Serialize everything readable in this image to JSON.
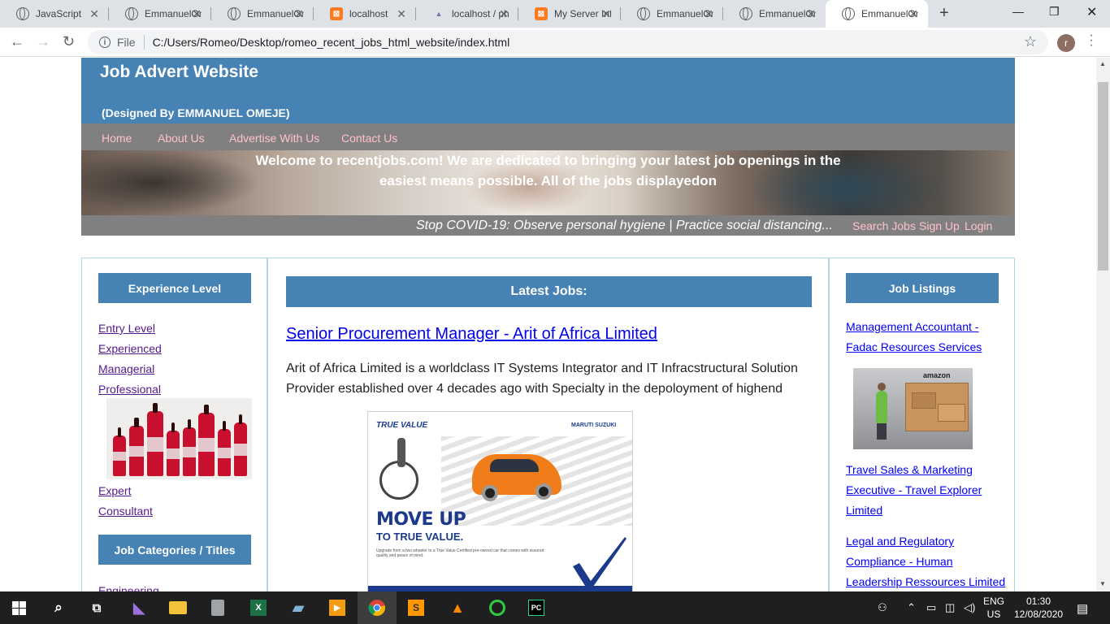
{
  "browser": {
    "tabs": [
      {
        "title": "JavaScript",
        "icon": "globe-icon"
      },
      {
        "title": "EmmanuelOmeje",
        "icon": "globe-icon"
      },
      {
        "title": "EmmanuelOmeje",
        "icon": "globe-icon"
      },
      {
        "title": "localhost",
        "icon": "xampp-icon"
      },
      {
        "title": "localhost / phpMyAdmin",
        "icon": "phpmyadmin-icon"
      },
      {
        "title": "My Server Info",
        "icon": "xampp-icon"
      },
      {
        "title": "EmmanuelOmeje",
        "icon": "globe-icon"
      },
      {
        "title": "EmmanuelOmeje",
        "icon": "globe-icon"
      },
      {
        "title": "EmmanuelOmeje",
        "icon": "globe-icon",
        "active": true
      }
    ],
    "file_label": "File",
    "url": "C:/Users/Romeo/Desktop/romeo_recent_jobs_html_website/index.html",
    "avatar_letter": "r"
  },
  "header": {
    "title": "Job Advert Website",
    "designer": "(Designed By EMMANUEL OMEJE)"
  },
  "nav": {
    "items": [
      "Home",
      "About Us",
      "Advertise With Us",
      "Contact Us"
    ]
  },
  "banner": {
    "welcome": "Welcome to recentjobs.com! We are dedicated to bringing your latest job openings in the easiest means possible. All of the jobs displayedon"
  },
  "ticker": {
    "text": "Stop COVID-19: Observe personal hygiene | Practice social distancing...",
    "links": [
      "Search Jobs",
      "Sign Up",
      "Login"
    ]
  },
  "left": {
    "experience_heading": "Experience Level",
    "experience_links": [
      "Entry Level",
      "Experienced",
      "Managerial",
      "Professional",
      "Expert",
      "Consultant"
    ],
    "categories_heading": "Job Categories / Titles",
    "category_links": [
      "Engineering"
    ]
  },
  "main": {
    "heading": "Latest Jobs:",
    "job_title": "Senior Procurement Manager - Arit of Africa Limited",
    "job_description": "Arit of Africa Limited is a worldclass IT Systems Integrator and IT Infracstructural Solution Provider established over 4 decades ago with Specialty in the depoloyment of highend",
    "ad": {
      "brand_left": "TRUE VALUE",
      "brand_right": "MARUTI SUZUKI",
      "headline": "MOVE UP",
      "subheadline": "TO TRUE VALUE.",
      "body": "Upgrade from a two wheeler to a True Value Certified pre-owned car that comes with assured quality and peace of mind."
    }
  },
  "right": {
    "heading": "Job Listings",
    "listings": [
      {
        "line1": "Management Accountant -",
        "line2": "Fadac Resources Services"
      },
      {
        "line1": "Travel Sales & Marketing",
        "line2": "Executive - Travel Explorer",
        "line3": "Limited"
      },
      {
        "line1": "Legal and Regulatory",
        "line2": "Compliance - Human",
        "line3": "Leadership Ressources Limited"
      }
    ],
    "warehouse_caption": "amazon"
  },
  "taskbar": {
    "lang_line1": "ENG",
    "lang_line2": "US",
    "time": "01:30",
    "date": "12/08/2020"
  },
  "colors": {
    "header_blue": "#4682b4",
    "nav_gray": "#808080",
    "nav_link_pink": "#ffc0cb",
    "border_lightblue": "#add8e6"
  }
}
